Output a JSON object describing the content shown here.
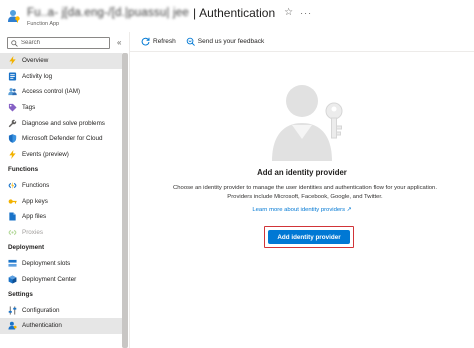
{
  "header": {
    "resource_name": "Fu..a- j[da.eng-/[d.|puassu| jee",
    "title_separator": "|",
    "page_title": "Authentication",
    "subtitle": "Function App",
    "favorite_icon": "star-icon",
    "more_icon": "ellipsis-icon"
  },
  "sidebar": {
    "search_placeholder": "Search",
    "collapse_glyph": "«",
    "items": [
      {
        "label": "Overview",
        "icon": "lightning-icon",
        "selected": true
      },
      {
        "label": "Activity log",
        "icon": "activity-log-icon"
      },
      {
        "label": "Access control (IAM)",
        "icon": "people-icon"
      },
      {
        "label": "Tags",
        "icon": "tag-icon"
      },
      {
        "label": "Diagnose and solve problems",
        "icon": "wrench-icon"
      },
      {
        "label": "Microsoft Defender for Cloud",
        "icon": "shield-icon"
      },
      {
        "label": "Events (preview)",
        "icon": "bolt-icon"
      }
    ],
    "section_functions": "Functions",
    "functions_items": [
      {
        "label": "Functions",
        "icon": "function-icon"
      },
      {
        "label": "App keys",
        "icon": "key-icon"
      },
      {
        "label": "App files",
        "icon": "file-icon"
      },
      {
        "label": "Proxies",
        "icon": "proxy-icon",
        "disabled": true
      }
    ],
    "section_deployment": "Deployment",
    "deployment_items": [
      {
        "label": "Deployment slots",
        "icon": "slots-icon"
      },
      {
        "label": "Deployment Center",
        "icon": "cube-icon"
      }
    ],
    "section_settings": "Settings",
    "settings_items": [
      {
        "label": "Configuration",
        "icon": "sliders-icon"
      },
      {
        "label": "Authentication",
        "icon": "person-icon",
        "active": true
      }
    ]
  },
  "toolbar": {
    "refresh_label": "Refresh",
    "feedback_label": "Send us your feedback"
  },
  "main": {
    "heading": "Add an identity provider",
    "description": "Choose an identity provider to manage the user identities and authentication flow for your application. Providers include Microsoft, Facebook, Google, and Twitter.",
    "learn_link": "Learn more about identity providers ↗",
    "add_button": "Add identity provider"
  },
  "colors": {
    "accent": "#0078d4",
    "highlight": "#d13438",
    "selected_bg": "#e6e6e6"
  }
}
